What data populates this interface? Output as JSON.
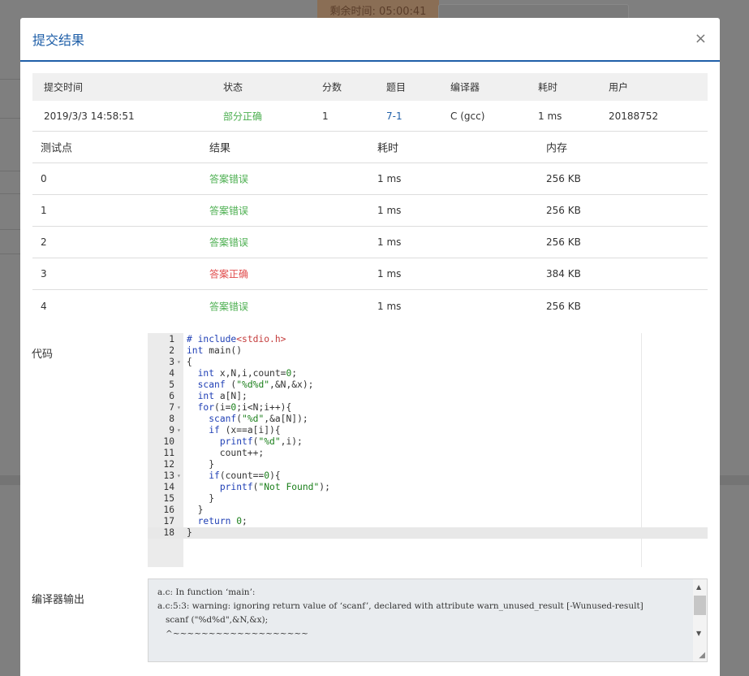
{
  "background": {
    "timer": "剩余时间: 05:00:41"
  },
  "modal": {
    "title": "提交结果",
    "close": "×"
  },
  "summary": {
    "headers": [
      "提交时间",
      "状态",
      "分数",
      "题目",
      "编译器",
      "耗时",
      "用户"
    ],
    "row": {
      "time": "2019/3/3 14:58:51",
      "status": "部分正确",
      "score": "1",
      "problem": "7-1",
      "compiler": "C (gcc)",
      "elapsed": "1 ms",
      "user": "20188752"
    }
  },
  "cases": {
    "headers": [
      "测试点",
      "结果",
      "耗时",
      "内存"
    ],
    "rows": [
      {
        "id": "0",
        "result": "答案错误",
        "time": "1 ms",
        "memory": "256 KB"
      },
      {
        "id": "1",
        "result": "答案错误",
        "time": "1 ms",
        "memory": "256 KB"
      },
      {
        "id": "2",
        "result": "答案错误",
        "time": "1 ms",
        "memory": "256 KB"
      },
      {
        "id": "3",
        "result": "答案正确",
        "time": "1 ms",
        "memory": "384 KB"
      },
      {
        "id": "4",
        "result": "答案错误",
        "time": "1 ms",
        "memory": "256 KB"
      }
    ]
  },
  "code": {
    "label": "代码",
    "lines": [
      "1",
      "2",
      "3",
      "4",
      "5",
      "6",
      "7",
      "8",
      "9",
      "10",
      "11",
      "12",
      "13",
      "14",
      "15",
      "16",
      "17",
      "18"
    ]
  },
  "compiler_output": {
    "label": "编译器输出",
    "text": "a.c: In function ‘main’:\na.c:5:3: warning: ignoring return value of ‘scanf’, declared with attribute warn_unused_result [-Wunused-result]\n   scanf (\"%d%d\",&N,&x);\n   ^~~~~~~~~~~~~~~~~~~~"
  },
  "colors": {
    "accent": "#1f5fa8",
    "correct": "#e04b4b",
    "wrong": "#4caf50"
  }
}
